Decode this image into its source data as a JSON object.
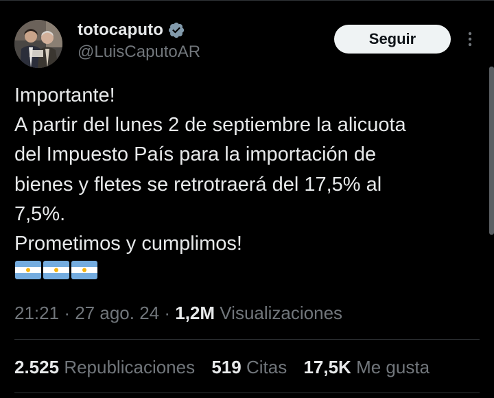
{
  "tweet": {
    "author": {
      "display_name": "totocaputo",
      "handle": "@LuisCaputoAR",
      "verified_icon": "verified-badge-icon"
    },
    "follow_label": "Seguir",
    "more_icon": "more-options-icon",
    "text_lines": [
      "Importante!",
      "A partir del lunes 2 de septiembre la alicuota",
      "del Impuesto País para la importación de",
      "bienes y fletes se retrotraerá del 17,5% al",
      "7,5%.",
      "Prometimos y cumplimos!"
    ],
    "flags": [
      "argentina-flag",
      "argentina-flag",
      "argentina-flag"
    ],
    "time": "21:21",
    "date": "27 ago. 24",
    "separator": "·",
    "views_count": "1,2M",
    "views_label": "Visualizaciones",
    "stats": {
      "reposts_count": "2.525",
      "reposts_label": "Republicaciones",
      "quotes_count": "519",
      "quotes_label": "Citas",
      "likes_count": "17,5K",
      "likes_label": "Me gusta"
    }
  },
  "colors": {
    "background": "#000000",
    "text_primary": "#e7e9ea",
    "text_secondary": "#71767b",
    "divider": "#2f3336",
    "verified": "#829aab",
    "follow_bg": "#eff3f4",
    "flag_blue": "#74acdf",
    "flag_white": "#ffffff",
    "flag_sun": "#f6b40e"
  }
}
